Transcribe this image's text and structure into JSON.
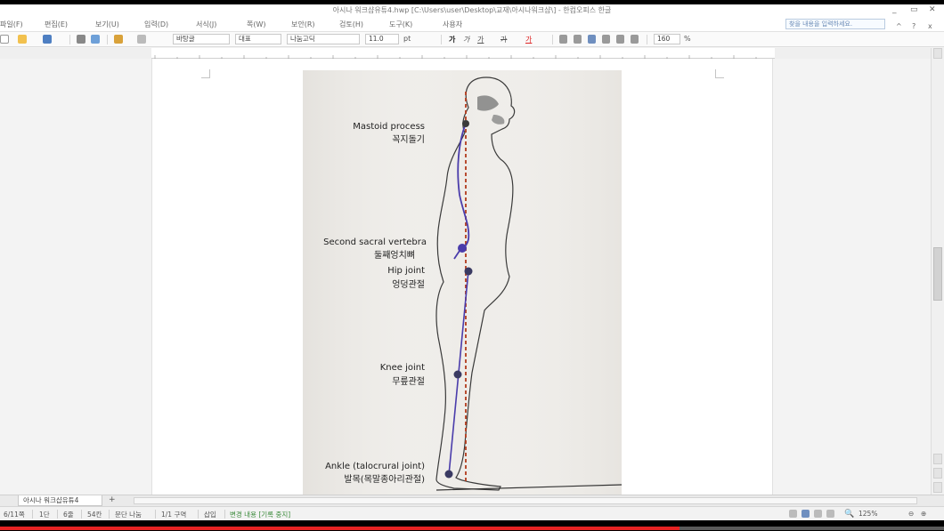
{
  "window": {
    "title": "아시나 워크샵유튜4.hwp [C:\\Users\\user\\Desktop\\교재\\아시나워크샵\\] - 한컴오피스 한글",
    "controls": [
      "_",
      "▭",
      "✕"
    ]
  },
  "menu": {
    "items": [
      "파일(F)",
      "편집(E)",
      "보기(U)",
      "입력(D)",
      "서식(J)",
      "쪽(W)",
      "보안(R)",
      "검토(H)",
      "도구(K)",
      "사용자"
    ],
    "help_placeholder": "찾을 내용을 입력하세요.",
    "right_controls": [
      "^",
      "?",
      "x"
    ]
  },
  "toolbar": {
    "style": "바탕글",
    "lang": "대표",
    "font": "나눔고딕",
    "size": "11.0",
    "size_unit": "pt",
    "bold": "가",
    "italic": "가",
    "underline": "가",
    "strike": "가",
    "font_color": "가",
    "zoom": "160",
    "zoom_unit": "%"
  },
  "figure": {
    "labels": {
      "mastoid_en": "Mastoid process",
      "mastoid_ko": "꼭지돌기",
      "sacral_en": "Second sacral vertebra",
      "sacral_ko": "둘째엉치뼈",
      "hip_en": "Hip joint",
      "hip_ko": "엉덩관절",
      "knee_en": "Knee joint",
      "knee_ko": "무릎관절",
      "ankle_en": "Ankle (talocrural joint)",
      "ankle_ko": "발목(목말종아리관절)"
    },
    "colors": {
      "paper": "#eeece8",
      "line_of_gravity": "#b23a1c",
      "spine": "#4a3cab",
      "outline": "#3a3a3a"
    }
  },
  "tabs": {
    "doc_tab": "아시나 워크샵유튜4",
    "add": "+"
  },
  "status": {
    "page": "6/11쪽",
    "section": "1단",
    "line": "6줄",
    "col": "54칸",
    "break": "문단 나눔",
    "section_count": "1/1 구역",
    "mode": "삽입",
    "track": "변경 내용 [기록 중지]",
    "zoom": "125%"
  },
  "video": {
    "progress": 0.72,
    "color": "#e52222"
  }
}
